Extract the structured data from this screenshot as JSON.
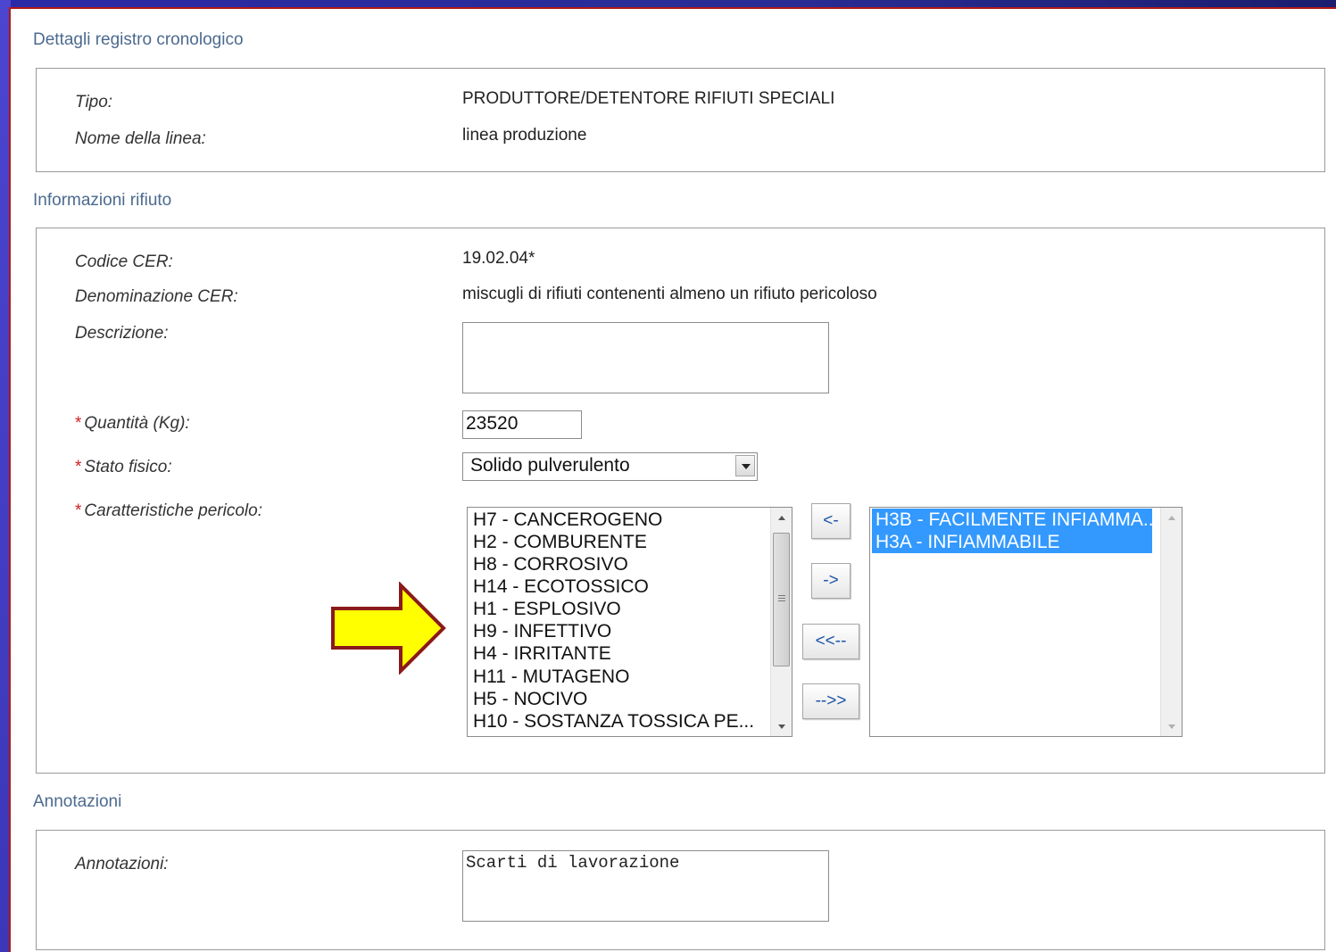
{
  "sections": {
    "dettagli": {
      "title": "Dettagli registro cronologico",
      "tipo_label": "Tipo:",
      "tipo_value": "PRODUTTORE/DETENTORE RIFIUTI SPECIALI",
      "nome_linea_label": "Nome della linea:",
      "nome_linea_value": "linea produzione"
    },
    "rifiuto": {
      "title": "Informazioni rifiuto",
      "codice_label": "Codice CER:",
      "codice_value": "19.02.04*",
      "denominazione_label": "Denominazione CER:",
      "denominazione_value": "miscugli di rifiuti contenenti almeno un rifiuto pericoloso",
      "descrizione_label": "Descrizione:",
      "descrizione_value": "",
      "required_mark": "*",
      "quantita_label": "Quantità (Kg):",
      "quantita_value": "23520",
      "stato_label": "Stato fisico:",
      "stato_value": "Solido pulverulento",
      "caratteristiche_label": "Caratteristiche pericolo:",
      "available": [
        "H7 - CANCEROGENO",
        "H2 - COMBURENTE",
        "H8 - CORROSIVO",
        "H14 - ECOTOSSICO",
        "H1 - ESPLOSIVO",
        "H9 - INFETTIVO",
        "H4 - IRRITANTE",
        "H11 - MUTAGENO",
        "H5 - NOCIVO",
        "H10 - SOSTANZA TOSSICA PE..."
      ],
      "selected": [
        "H3B - FACILMENTE INFIAMMA...",
        "H3A - INFIAMMABILE"
      ],
      "buttons": {
        "move_left": "<-",
        "move_right": "->",
        "move_all_left": "<<--",
        "move_all_right": "-->>"
      }
    },
    "annotazioni": {
      "title": "Annotazioni",
      "label": "Annotazioni:",
      "value": "Scarti di lavorazione"
    }
  },
  "colors": {
    "section_title": "#4c6a8f",
    "required": "#d02020",
    "selection": "#3399ff",
    "arrow_fill": "#ffff00",
    "arrow_stroke": "#8b1a1a",
    "frame": "#3a36b8"
  },
  "decorations": {
    "pointer": "right-arrow-icon"
  }
}
